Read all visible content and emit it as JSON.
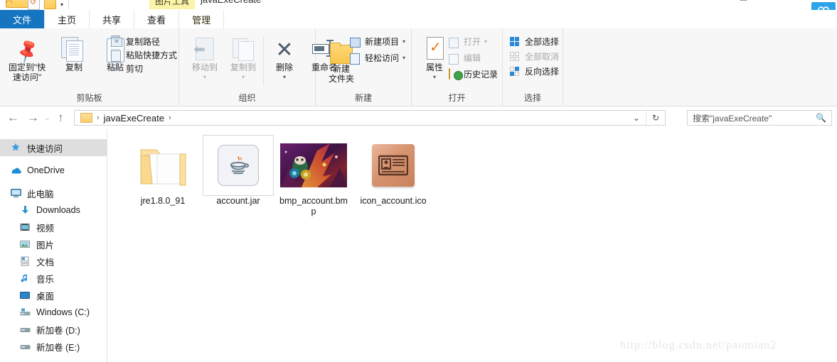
{
  "window": {
    "title": "javaExeCreate",
    "contextual_tab_title": "图片工具",
    "quick_access": [
      "folder-icon",
      "undo-icon",
      "folder-icon",
      "chevron-down-icon"
    ],
    "controls": [
      "minimize-icon",
      "restore-icon",
      "close-icon"
    ],
    "cloud_button": "baidu-cloud-icon"
  },
  "tabs": [
    {
      "label": "文件",
      "name": "tab-file"
    },
    {
      "label": "主页",
      "name": "tab-home"
    },
    {
      "label": "共享",
      "name": "tab-share"
    },
    {
      "label": "查看",
      "name": "tab-view"
    },
    {
      "label": "管理",
      "name": "tab-manage"
    }
  ],
  "ribbon": {
    "groups": [
      {
        "label": "剪贴板",
        "big_buttons": [
          {
            "label1": "固定到\"快",
            "label2": "速访问\""
          },
          {
            "label1": "复制",
            "label2": ""
          },
          {
            "label1": "粘贴",
            "label2": ""
          }
        ],
        "small_buttons": [
          {
            "label": "复制路径",
            "disabled": false
          },
          {
            "label": "粘贴快捷方式",
            "disabled": false
          },
          {
            "label": "剪切",
            "disabled": false
          }
        ]
      },
      {
        "label": "组织",
        "big_buttons": [
          {
            "label1": "移动到",
            "label2": ""
          },
          {
            "label1": "复制到",
            "label2": ""
          },
          {
            "label1": "删除",
            "label2": ""
          },
          {
            "label1": "重命名",
            "label2": ""
          }
        ],
        "small_buttons": []
      },
      {
        "label": "新建",
        "big_buttons": [
          {
            "label1": "新建",
            "label2": "文件夹"
          }
        ],
        "small_buttons": [
          {
            "label": "新建项目",
            "disabled": false
          },
          {
            "label": "轻松访问",
            "disabled": false
          }
        ]
      },
      {
        "label": "打开",
        "big_buttons": [
          {
            "label1": "属性",
            "label2": ""
          }
        ],
        "small_buttons": [
          {
            "label": "打开",
            "disabled": true
          },
          {
            "label": "编辑",
            "disabled": true
          },
          {
            "label": "历史记录",
            "disabled": false
          }
        ]
      },
      {
        "label": "选择",
        "big_buttons": [],
        "small_buttons": [
          {
            "label": "全部选择",
            "disabled": false
          },
          {
            "label": "全部取消",
            "disabled": true
          },
          {
            "label": "反向选择",
            "disabled": false
          }
        ]
      }
    ]
  },
  "address": {
    "back": "back-arrow-icon",
    "forward": "forward-arrow-icon",
    "recent": "chevron-down-icon",
    "up": "up-arrow-icon",
    "crumb": "javaExeCreate",
    "crumb_sep_left": "›",
    "crumb_sep_right": "›",
    "history_caret": "⌄",
    "refresh": "↻"
  },
  "search": {
    "placeholder": "搜索\"javaExeCreate\"",
    "icon": "search-icon"
  },
  "navpane": {
    "items": [
      {
        "label": "快速访问",
        "icon": "pin-star-icon",
        "level": 0,
        "selected": true
      },
      {
        "label": "OneDrive",
        "icon": "onedrive-cloud-icon",
        "level": 0,
        "selected": false
      },
      {
        "label": "此电脑",
        "icon": "this-pc-icon",
        "level": 0,
        "selected": false
      },
      {
        "label": "Downloads",
        "icon": "downloads-icon",
        "level": 1,
        "selected": false
      },
      {
        "label": "视频",
        "icon": "videos-icon",
        "level": 1,
        "selected": false
      },
      {
        "label": "图片",
        "icon": "pictures-icon",
        "level": 1,
        "selected": false
      },
      {
        "label": "文档",
        "icon": "documents-icon",
        "level": 1,
        "selected": false
      },
      {
        "label": "音乐",
        "icon": "music-icon",
        "level": 1,
        "selected": false
      },
      {
        "label": "桌面",
        "icon": "desktop-icon",
        "level": 1,
        "selected": false
      },
      {
        "label": "Windows (C:)",
        "icon": "system-drive-icon",
        "level": 1,
        "selected": false
      },
      {
        "label": "新加卷 (D:)",
        "icon": "drive-icon",
        "level": 1,
        "selected": false
      },
      {
        "label": "新加卷 (E:)",
        "icon": "drive-icon",
        "level": 1,
        "selected": false
      }
    ]
  },
  "files": [
    {
      "name": "jre1.8.0_91",
      "type": "folder",
      "selected": false
    },
    {
      "name": "account.jar",
      "type": "jar",
      "selected": true
    },
    {
      "name": "bmp_account.bmp",
      "type": "bmp",
      "selected": false
    },
    {
      "name": "icon_account.ico",
      "type": "ico",
      "selected": false
    }
  ],
  "watermark": "http://blog.csdn.net/paomian2",
  "colors": {
    "file_tab_blue": "#1675c0",
    "contextual_yellow": "#fdf3a8",
    "ribbon_bg": "#f7f7f7",
    "selection_gray": "#dedede",
    "cloud_blue": "#2ea4e8"
  }
}
